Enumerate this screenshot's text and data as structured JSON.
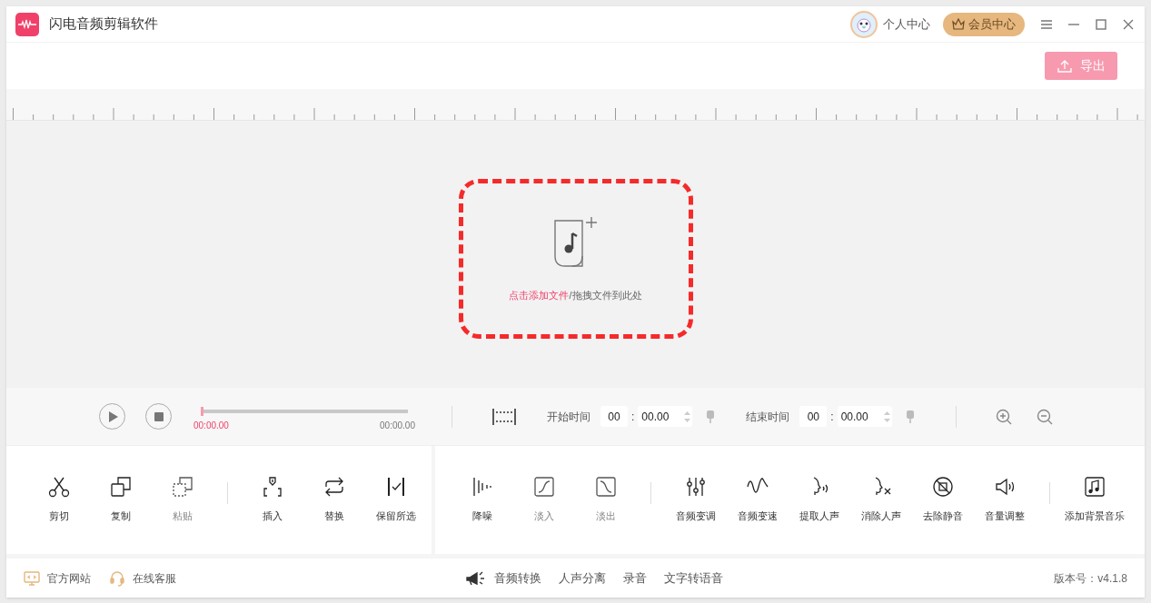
{
  "window": {
    "title": "闪电音频剪辑软件",
    "user_label": "个人中心",
    "vip_button": "会员中心"
  },
  "export_button": "导出",
  "drop_zone": {
    "link": "点击添加文件",
    "hint": "/拖拽文件到此处"
  },
  "player": {
    "level": 0,
    "current_time": "00:00.00",
    "total_time": "00:00.00"
  },
  "selection": {
    "start": {
      "label": "开始时间",
      "minutes": "00",
      "separator": ":",
      "seconds": "00.00"
    },
    "end": {
      "label": "结束时间",
      "minutes": "00",
      "separator": ":",
      "seconds": "00.00"
    }
  },
  "tool_panels": [
    {
      "sections": [
        [
          {
            "kind": "scissors",
            "label": "剪切",
            "disabled": false
          },
          {
            "kind": "copy",
            "label": "复制",
            "disabled": false
          },
          {
            "kind": "paste",
            "label": "粘贴",
            "disabled": true
          }
        ],
        [
          {
            "kind": "insert",
            "label": "插入",
            "disabled": false
          },
          {
            "kind": "replace",
            "label": "替换",
            "disabled": false
          },
          {
            "kind": "keep",
            "label": "保留所选",
            "disabled": false
          }
        ]
      ]
    },
    {
      "sections": [
        [
          {
            "kind": "denoise",
            "label": "降噪",
            "disabled": false
          },
          {
            "kind": "fadein",
            "label": "淡入",
            "disabled": true
          },
          {
            "kind": "fadeout",
            "label": "淡出",
            "disabled": true
          }
        ],
        [
          {
            "kind": "pitch",
            "label": "音频变调",
            "disabled": false
          },
          {
            "kind": "speed",
            "label": "音频变速",
            "disabled": false
          },
          {
            "kind": "extract",
            "label": "提取人声",
            "disabled": false
          },
          {
            "kind": "remove",
            "label": "消除人声",
            "disabled": false
          },
          {
            "kind": "silence",
            "label": "去除静音",
            "disabled": false
          },
          {
            "kind": "volume",
            "label": "音量调整",
            "disabled": false
          }
        ],
        [
          {
            "kind": "music",
            "label": "添加背景音乐",
            "disabled": false
          }
        ]
      ]
    }
  ],
  "footer": {
    "left": [
      {
        "kind": "monitor",
        "label": "官方网站"
      },
      {
        "kind": "headset",
        "label": "在线客服"
      }
    ],
    "center": [
      "音频转换",
      "人声分离",
      "录音",
      "文字转语音"
    ],
    "version": "版本号：v4.1.8"
  }
}
